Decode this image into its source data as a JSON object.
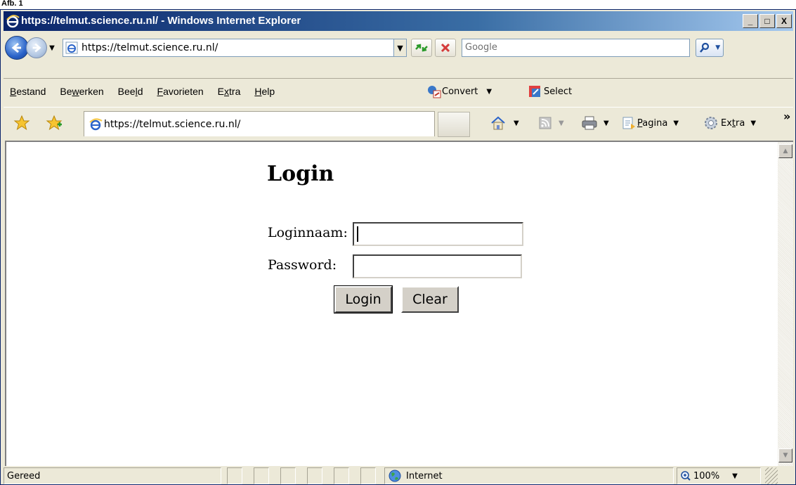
{
  "window": {
    "title": "https://telmut.science.ru.nl/ - Windows Internet Explorer",
    "minimize": "_",
    "maximize": "□",
    "close": "X"
  },
  "addressbar": {
    "url": "https://telmut.science.ru.nl/",
    "search_placeholder": "Google"
  },
  "menu": {
    "items": [
      {
        "pre": "",
        "u": "B",
        "post": "estand"
      },
      {
        "pre": "Be",
        "u": "w",
        "post": "erken"
      },
      {
        "pre": "Bee",
        "u": "l",
        "post": "d"
      },
      {
        "pre": "",
        "u": "F",
        "post": "avorieten"
      },
      {
        "pre": "E",
        "u": "x",
        "post": "tra"
      },
      {
        "pre": "",
        "u": "H",
        "post": "elp"
      }
    ],
    "convert_label": "Convert",
    "select_label": "Select"
  },
  "tab": {
    "title": "https://telmut.science.ru.nl/"
  },
  "commandbar": {
    "page_pre": "",
    "page_u": "P",
    "page_post": "agina",
    "extra_pre": "Ex",
    "extra_u": "t",
    "extra_post": "ra",
    "overflow": "»"
  },
  "page": {
    "heading": "Login",
    "username_label": "Loginnaam:",
    "password_label": "Password:",
    "login_button": "Login",
    "clear_button": "Clear"
  },
  "statusbar": {
    "status": "Gereed",
    "zone": "Internet",
    "zoom": "100%"
  },
  "colors": {
    "titlebar_start": "#0a246a",
    "chrome": "#ece9d8",
    "ie_blue": "#2a63c9"
  }
}
